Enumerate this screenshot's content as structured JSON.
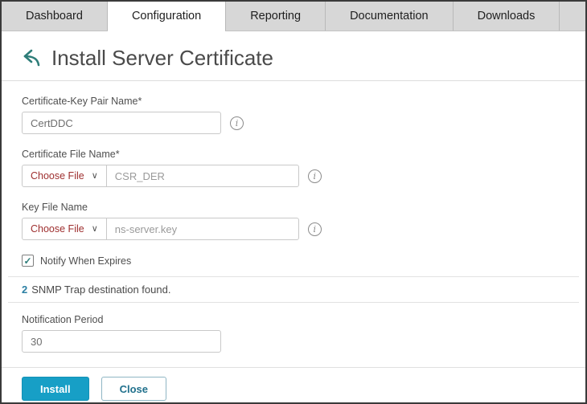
{
  "tabs": [
    {
      "label": "Dashboard"
    },
    {
      "label": "Configuration",
      "active": true
    },
    {
      "label": "Reporting"
    },
    {
      "label": "Documentation"
    },
    {
      "label": "Downloads"
    }
  ],
  "header": {
    "title": "Install Server Certificate"
  },
  "icons": {
    "info": "i",
    "chevron_down": "∨",
    "check": "✓",
    "back_arrow": "←"
  },
  "form": {
    "cert_key_pair_name": {
      "label": "Certificate-Key Pair Name*",
      "value": "CertDDC"
    },
    "certificate_file_name": {
      "label": "Certificate File Name*",
      "choose_file": "Choose File",
      "value": "CSR_DER"
    },
    "key_file_name": {
      "label": "Key File Name",
      "choose_file": "Choose File",
      "value": "ns-server.key"
    },
    "notify_when_expires": {
      "label": "Notify When Expires",
      "checked": true
    },
    "snmp_message": {
      "count": "2",
      "text": "SNMP Trap destination found."
    },
    "notification_period": {
      "label": "Notification Period",
      "value": "30"
    }
  },
  "footer": {
    "install": "Install",
    "close": "Close"
  },
  "colors": {
    "accent": "#179fc6",
    "back_arrow": "#2e7d79",
    "choose_file_text": "#9e2f2f",
    "snmp_count": "#2b7fa3",
    "tab_bar_bg": "#d7d7d7"
  }
}
